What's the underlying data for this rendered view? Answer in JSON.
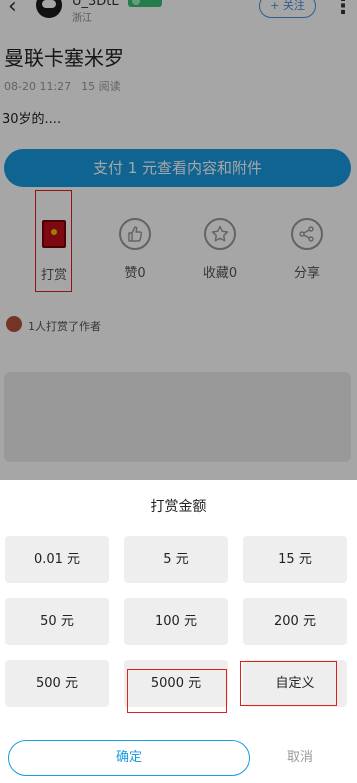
{
  "header": {
    "back_icon": "chevron-left-icon",
    "username": "U_3DtL",
    "location": "浙江",
    "follow_label": "+ 关注",
    "more_icon": "more-vertical-icon"
  },
  "post": {
    "title": "曼联卡塞米罗",
    "date": "08-20 11:27",
    "reads": "15 阅读",
    "body": "30岁的...."
  },
  "pay_button_label": "支付 1 元查看内容和附件",
  "actions": [
    {
      "label": "打赏",
      "icon": "red-envelope-icon"
    },
    {
      "label": "赞0",
      "icon": "thumbs-up-icon"
    },
    {
      "label": "收藏0",
      "icon": "star-icon"
    },
    {
      "label": "分享",
      "icon": "share-icon"
    }
  ],
  "rewarders_text": "1人打赏了作者",
  "sheet": {
    "title": "打赏金额",
    "amounts": [
      "0.01 元",
      "5 元",
      "15 元",
      "50 元",
      "100 元",
      "200 元",
      "500 元",
      "5000 元",
      "自定义"
    ],
    "confirm_label": "确定",
    "cancel_label": "取消"
  },
  "colors": {
    "accent": "#1a9ae0",
    "highlight": "#e02020",
    "level_badge": "#38c172"
  }
}
